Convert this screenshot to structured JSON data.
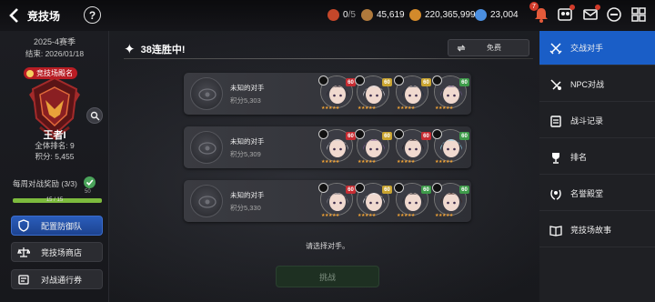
{
  "header": {
    "title": "竞技场",
    "help_label": "?",
    "resources": {
      "tickets": "0",
      "tickets_max": "/5",
      "gold": "45,619",
      "credits": "220,365,999",
      "gems": "23,004"
    },
    "notification_count": "7"
  },
  "season": {
    "name": "2025-4赛季",
    "end": "结束: 2026/01/18",
    "hall_of_fame_label": "竞技场殿名",
    "tier": "王者I",
    "overall_rank": "全体排名: 9",
    "points": "积分: 5,455",
    "weekly_reward_label": "每周对战奖励 (3/3)",
    "weekly_reward_count": "50",
    "weekly_progress_text": "15 / 15",
    "weekly_progress_fraction": 1.0
  },
  "side_buttons": {
    "defense": "配置防御队",
    "shop": "竞技场商店",
    "pass": "对战通行券"
  },
  "streak": {
    "title": "38连胜中!",
    "refresh_label": "免费"
  },
  "opponents": [
    {
      "name": "未知的对手",
      "score": "积分5,303",
      "heroes": [
        {
          "level": "60",
          "level_color": "#c72c32"
        },
        {
          "level": "60",
          "level_color": "#c9a430"
        },
        {
          "level": "60",
          "level_color": "#c9a430"
        },
        {
          "level": "60",
          "level_color": "#3e9b4a"
        }
      ]
    },
    {
      "name": "未知的对手",
      "score": "积分5,309",
      "heroes": [
        {
          "level": "60",
          "level_color": "#c72c32"
        },
        {
          "level": "60",
          "level_color": "#c9a430"
        },
        {
          "level": "60",
          "level_color": "#c72c32"
        },
        {
          "level": "60",
          "level_color": "#3e9b4a"
        }
      ]
    },
    {
      "name": "未知的对手",
      "score": "积分5,330",
      "heroes": [
        {
          "level": "60",
          "level_color": "#c72c32"
        },
        {
          "level": "60",
          "level_color": "#c9a430"
        },
        {
          "level": "60",
          "level_color": "#3e9b4a"
        },
        {
          "level": "60",
          "level_color": "#3e9b4a"
        }
      ]
    }
  ],
  "hero_stars": "★★★★★",
  "select_hint": "请选择对手。",
  "fight_label": "挑战",
  "right_menu": [
    {
      "label": "交战对手",
      "icon": "crossed-swords-icon"
    },
    {
      "label": "NPC对战",
      "icon": "npc-swords-icon"
    },
    {
      "label": "战斗记录",
      "icon": "clipboard-icon"
    },
    {
      "label": "排名",
      "icon": "trophy-icon"
    },
    {
      "label": "名誉殿堂",
      "icon": "laurel-icon"
    },
    {
      "label": "竞技场故事",
      "icon": "book-icon"
    }
  ],
  "colors": {
    "accent_blue": "#1a5ec7",
    "badge_red": "#b81d24",
    "progress_green": "#7dbb3e",
    "star_orange": "#f2a336"
  }
}
